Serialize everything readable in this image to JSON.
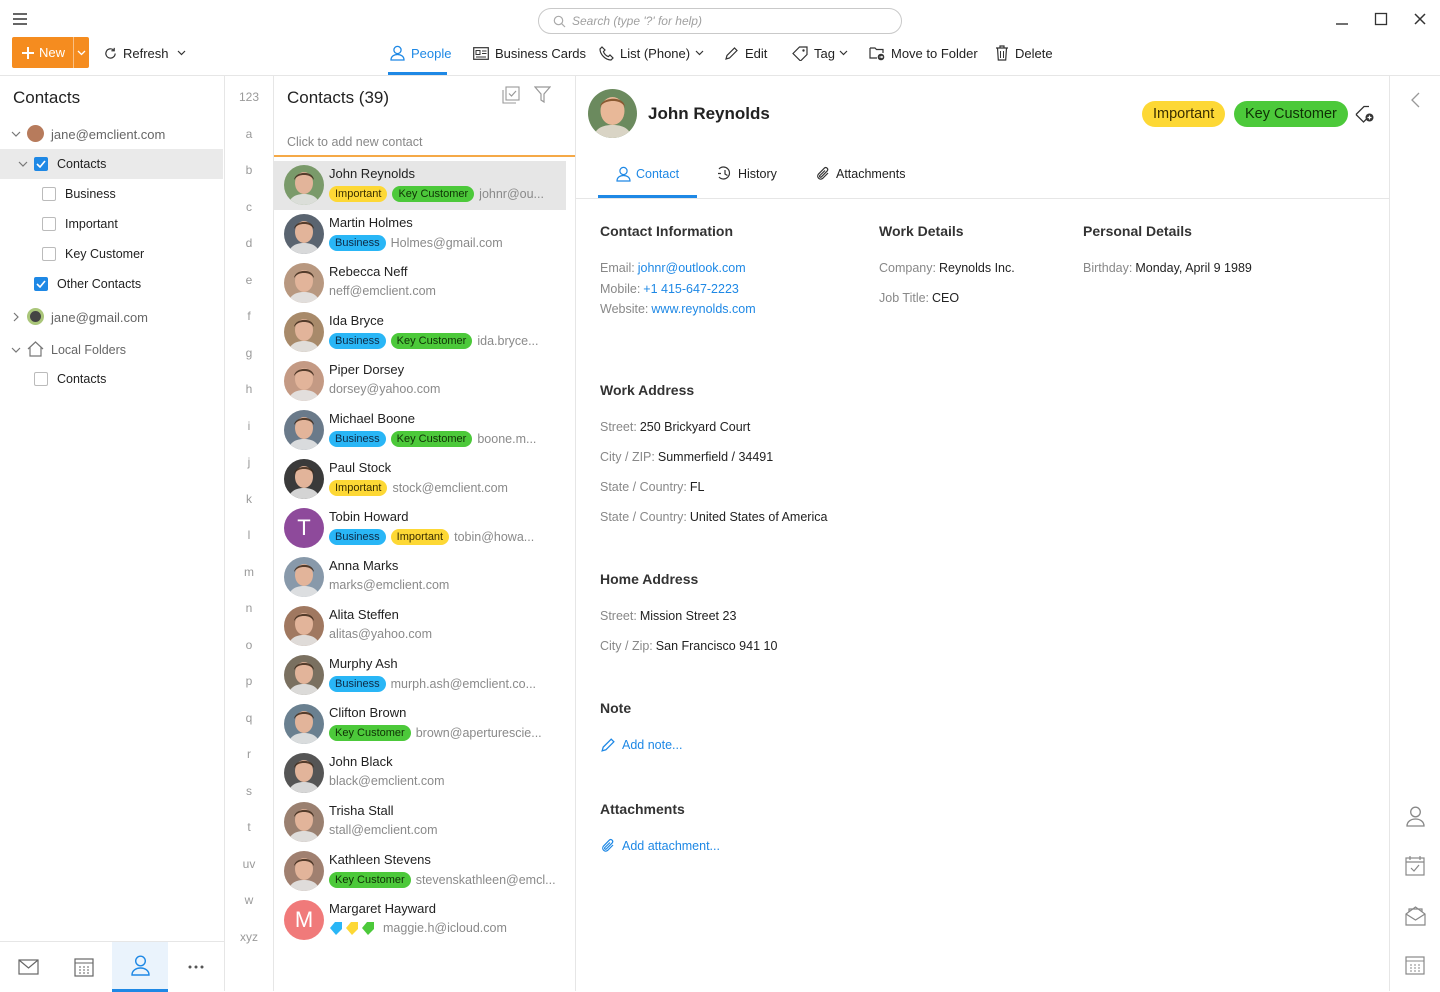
{
  "colors": {
    "accent": "#1e88e5",
    "new_button": "#f58c1f",
    "business": "#29b6f6",
    "important": "#fdd835",
    "key_customer": "#4cc93a"
  },
  "search": {
    "placeholder": "Search (type '?' for help)"
  },
  "toolbar": {
    "new": "New",
    "refresh": "Refresh",
    "people": "People",
    "business_cards": "Business Cards",
    "list_phone": "List (Phone)",
    "edit": "Edit",
    "tag": "Tag",
    "move_to_folder": "Move to Folder",
    "delete": "Delete"
  },
  "folders": {
    "title": "Contacts",
    "account1": "jane@emclient.com",
    "contacts": "Contacts",
    "business": "Business",
    "important": "Important",
    "key_customer": "Key Customer",
    "other_contacts": "Other Contacts",
    "account2": "jane@gmail.com",
    "local_folders": "Local Folders",
    "local_contacts": "Contacts"
  },
  "alphabet": [
    "123",
    "a",
    "b",
    "c",
    "d",
    "e",
    "f",
    "g",
    "h",
    "i",
    "j",
    "k",
    "l",
    "m",
    "n",
    "o",
    "p",
    "q",
    "r",
    "s",
    "t",
    "uv",
    "w",
    "xyz"
  ],
  "list": {
    "title": "Contacts (39)",
    "add_placeholder": "Click to add new contact",
    "contacts": [
      {
        "name": "John Reynolds",
        "tags": [
          "Important",
          "Key Customer"
        ],
        "email": "johnr@ou..."
      },
      {
        "name": "Martin Holmes",
        "tags": [
          "Business"
        ],
        "email": "Holmes@gmail.com"
      },
      {
        "name": "Rebecca Neff",
        "tags": [],
        "email": "neff@emclient.com"
      },
      {
        "name": "Ida Bryce",
        "tags": [
          "Business",
          "Key Customer"
        ],
        "email": "ida.bryce..."
      },
      {
        "name": "Piper Dorsey",
        "tags": [],
        "email": "dorsey@yahoo.com"
      },
      {
        "name": "Michael Boone",
        "tags": [
          "Business",
          "Key Customer"
        ],
        "email": "boone.m..."
      },
      {
        "name": "Paul Stock",
        "tags": [
          "Important"
        ],
        "email": "stock@emclient.com"
      },
      {
        "name": "Tobin Howard",
        "tags": [
          "Business",
          "Important"
        ],
        "email": "tobin@howa...",
        "initial": "T"
      },
      {
        "name": "Anna Marks",
        "tags": [],
        "email": "marks@emclient.com"
      },
      {
        "name": "Alita Steffen",
        "tags": [],
        "email": "alitas@yahoo.com"
      },
      {
        "name": "Murphy Ash",
        "tags": [
          "Business"
        ],
        "email": "murph.ash@emclient.co..."
      },
      {
        "name": "Clifton Brown",
        "tags": [
          "Key Customer"
        ],
        "email": "brown@aperturescie..."
      },
      {
        "name": "John Black",
        "tags": [],
        "email": "black@emclient.com"
      },
      {
        "name": "Trisha Stall",
        "tags": [],
        "email": "stall@emclient.com"
      },
      {
        "name": "Kathleen Stevens",
        "tags": [
          "Key Customer"
        ],
        "email": "stevenskathleen@emcl..."
      },
      {
        "name": "Margaret Hayward",
        "tags": [],
        "email": "maggie.h@icloud.com",
        "initial": "M"
      }
    ]
  },
  "detail": {
    "name": "John Reynolds",
    "tags": [
      "Important",
      "Key Customer"
    ],
    "tabs": {
      "contact": "Contact",
      "history": "History",
      "attachments": "Attachments"
    },
    "contact_info": {
      "heading": "Contact Information",
      "email_label": "Email:",
      "email": "johnr@outlook.com",
      "mobile_label": "Mobile:",
      "mobile": "+1 415-647-2223",
      "website_label": "Website:",
      "website": "www.reynolds.com"
    },
    "work_details": {
      "heading": "Work Details",
      "company_label": "Company:",
      "company": "Reynolds Inc.",
      "job_label": "Job Title:",
      "job": "CEO"
    },
    "personal_details": {
      "heading": "Personal Details",
      "birthday_label": "Birthday:",
      "birthday": "Monday, April 9 1989"
    },
    "work_address": {
      "heading": "Work Address",
      "street_label": "Street:",
      "street": "250 Brickyard Court",
      "city_label": "City / ZIP:",
      "city": "Summerfield / 34491",
      "state_label": "State / Country:",
      "state": "FL",
      "country_label": "State / Country:",
      "country": "United States of America"
    },
    "home_address": {
      "heading": "Home Address",
      "street_label": "Street:",
      "street": "Mission Street 23",
      "city_label": "City / Zip:",
      "city": "San Francisco 941 10"
    },
    "note": {
      "heading": "Note",
      "add": "Add note..."
    },
    "attachments": {
      "heading": "Attachments",
      "add": "Add attachment..."
    }
  }
}
